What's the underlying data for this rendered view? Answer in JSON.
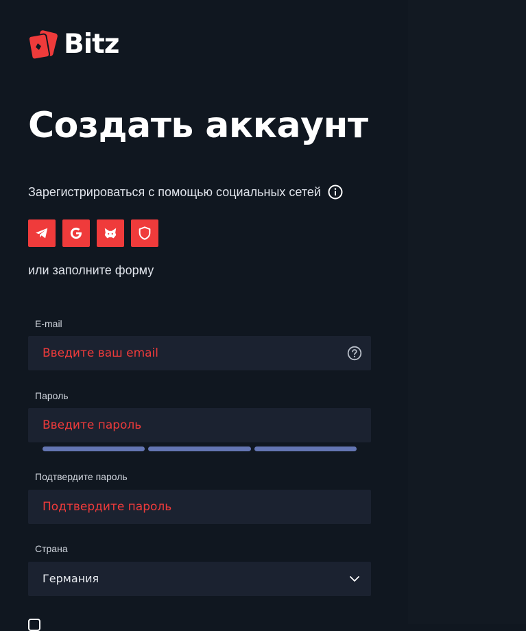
{
  "brand": {
    "name": "Bitz",
    "logo_color": "#ef3b3b"
  },
  "page": {
    "title": "Создать аккаунт",
    "social_label": "Зарегистрироваться с помощью социальных сетей",
    "or_text": "или заполните форму"
  },
  "social_buttons": [
    {
      "icon": "telegram-icon"
    },
    {
      "icon": "google-icon"
    },
    {
      "icon": "metamask-icon"
    },
    {
      "icon": "shield-icon"
    }
  ],
  "form": {
    "email": {
      "label": "E-mail",
      "placeholder": "Введите ваш email",
      "value": ""
    },
    "password": {
      "label": "Пароль",
      "placeholder": "Введите пароль",
      "value": ""
    },
    "confirm": {
      "label": "Подтвердите пароль",
      "placeholder": "Подтвердите пароль",
      "value": ""
    },
    "country": {
      "label": "Страна",
      "value": "Германия"
    }
  },
  "colors": {
    "accent": "#ef3b3b",
    "background": "#101720",
    "field": "#1b2230",
    "strength_bar": "#6476b3"
  }
}
